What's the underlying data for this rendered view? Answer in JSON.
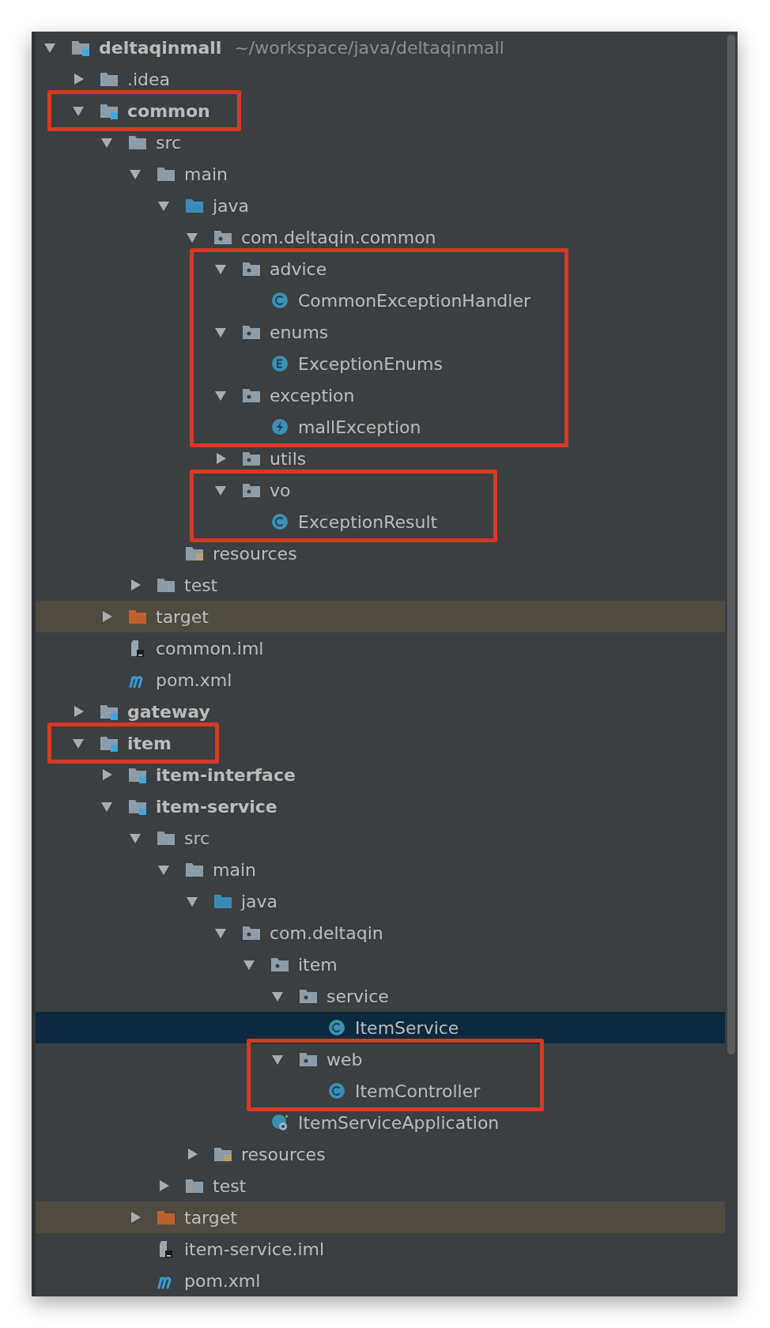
{
  "project_tree": {
    "nodes": [
      {
        "label": "deltaqinmall",
        "kind": "module",
        "path": "~/workspace/java/deltaqinmall",
        "expanded": true,
        "selected": false,
        "children": [
          {
            "label": ".idea",
            "kind": "folder",
            "expanded": false,
            "selected": false
          },
          {
            "label": "common",
            "kind": "module",
            "expanded": true,
            "selected": false,
            "frame_start": true,
            "frame_end": true,
            "children": [
              {
                "label": "src",
                "kind": "folder",
                "expanded": true,
                "selected": false,
                "children": [
                  {
                    "label": "main",
                    "kind": "folder",
                    "expanded": true,
                    "selected": false,
                    "children": [
                      {
                        "label": "java",
                        "kind": "source",
                        "expanded": true,
                        "selected": false,
                        "children": [
                          {
                            "label": "com.deltaqin.common",
                            "kind": "package",
                            "expanded": true,
                            "selected": false,
                            "children": [
                              {
                                "label": "advice",
                                "kind": "package",
                                "expanded": true,
                                "selected": false,
                                "frame_start": true,
                                "children": [
                                  {
                                    "label": "CommonExceptionHandler",
                                    "kind": "class",
                                    "selected": false
                                  }
                                ]
                              },
                              {
                                "label": "enums",
                                "kind": "package",
                                "expanded": true,
                                "selected": false,
                                "children": [
                                  {
                                    "label": "ExceptionEnums",
                                    "kind": "enum",
                                    "selected": false
                                  }
                                ]
                              },
                              {
                                "label": "exception",
                                "kind": "package",
                                "expanded": true,
                                "selected": false,
                                "frame_end": true,
                                "frame_wraps_children": true,
                                "children": [
                                  {
                                    "label": "mallException",
                                    "kind": "exception",
                                    "selected": false
                                  }
                                ]
                              },
                              {
                                "label": "utils",
                                "kind": "package",
                                "expanded": false,
                                "selected": false
                              },
                              {
                                "label": "vo",
                                "kind": "package",
                                "expanded": true,
                                "selected": false,
                                "frame_start": true,
                                "frame_end": true,
                                "frame_wraps_children": true,
                                "children": [
                                  {
                                    "label": "ExceptionResult",
                                    "kind": "class",
                                    "selected": false
                                  }
                                ]
                              }
                            ]
                          }
                        ]
                      },
                      {
                        "label": "resources",
                        "kind": "resources",
                        "selected": false
                      }
                    ]
                  },
                  {
                    "label": "test",
                    "kind": "folder",
                    "expanded": false,
                    "selected": false
                  }
                ]
              },
              {
                "label": "target",
                "kind": "excluded",
                "expanded": false,
                "selected": false
              },
              {
                "label": "common.iml",
                "kind": "iml",
                "selected": false
              },
              {
                "label": "pom.xml",
                "kind": "maven",
                "selected": false
              }
            ]
          },
          {
            "label": "gateway",
            "kind": "module",
            "expanded": false,
            "selected": false
          },
          {
            "label": "item",
            "kind": "module",
            "expanded": true,
            "selected": false,
            "frame_start": true,
            "frame_end": true,
            "children": [
              {
                "label": "item-interface",
                "kind": "module",
                "expanded": false,
                "selected": false
              },
              {
                "label": "item-service",
                "kind": "module",
                "expanded": true,
                "selected": false,
                "children": [
                  {
                    "label": "src",
                    "kind": "folder",
                    "expanded": true,
                    "selected": false,
                    "children": [
                      {
                        "label": "main",
                        "kind": "folder",
                        "expanded": true,
                        "selected": false,
                        "children": [
                          {
                            "label": "java",
                            "kind": "source",
                            "expanded": true,
                            "selected": false,
                            "children": [
                              {
                                "label": "com.deltaqin",
                                "kind": "package",
                                "expanded": true,
                                "selected": false,
                                "children": [
                                  {
                                    "label": "item",
                                    "kind": "package",
                                    "expanded": true,
                                    "selected": false,
                                    "children": [
                                      {
                                        "label": "service",
                                        "kind": "package",
                                        "expanded": true,
                                        "selected": false,
                                        "children": [
                                          {
                                            "label": "ItemService",
                                            "kind": "class",
                                            "selected": true
                                          }
                                        ]
                                      },
                                      {
                                        "label": "web",
                                        "kind": "package",
                                        "expanded": true,
                                        "selected": false,
                                        "frame_start": true,
                                        "frame_end": true,
                                        "frame_wraps_children": true,
                                        "children": [
                                          {
                                            "label": "ItemController",
                                            "kind": "class",
                                            "selected": false
                                          }
                                        ]
                                      }
                                    ]
                                  },
                                  {
                                    "label": "ItemServiceApplication",
                                    "kind": "spring",
                                    "selected": false
                                  }
                                ]
                              }
                            ]
                          },
                          {
                            "label": "resources",
                            "kind": "resources",
                            "expanded": false,
                            "selected": false
                          }
                        ]
                      },
                      {
                        "label": "test",
                        "kind": "folder",
                        "expanded": false,
                        "selected": false
                      }
                    ]
                  },
                  {
                    "label": "target",
                    "kind": "excluded",
                    "expanded": false,
                    "selected": false
                  },
                  {
                    "label": "item-service.iml",
                    "kind": "iml",
                    "selected": false
                  },
                  {
                    "label": "pom.xml",
                    "kind": "maven",
                    "selected": false
                  }
                ]
              }
            ]
          }
        ]
      }
    ]
  }
}
